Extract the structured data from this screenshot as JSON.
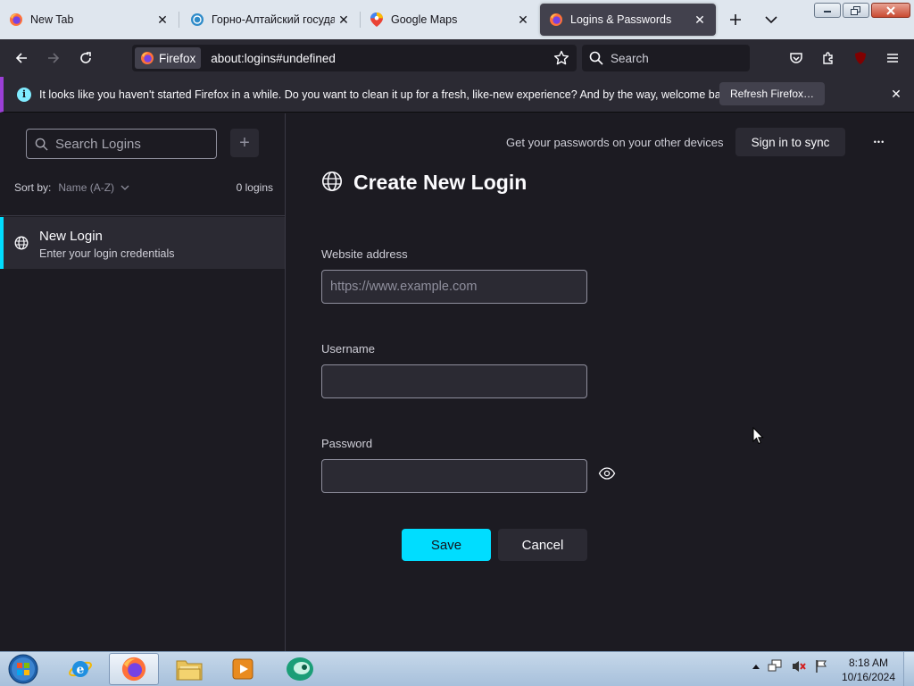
{
  "tabs": [
    {
      "title": "New Tab",
      "icon": "firefox-icon"
    },
    {
      "title": "Горно-Алтайский государственный университет",
      "icon": "site-icon"
    },
    {
      "title": "Google Maps",
      "icon": "maps-pin-icon"
    },
    {
      "title": "Logins & Passwords",
      "icon": "firefox-icon"
    }
  ],
  "nav": {
    "identity_label": "Firefox",
    "url": "about:logins#undefined",
    "search_placeholder": "Search",
    "extension_badge": "uO"
  },
  "notification": {
    "message": "It looks like you haven't started Firefox in a while. Do you want to clean it up for a fresh, like-new experience? And by the way, welcome back!",
    "refresh_label": "Refresh Firefox…"
  },
  "sidebar": {
    "search_placeholder": "Search Logins",
    "add_label": "+",
    "sort_label": "Sort by:",
    "sort_value": "Name (A-Z)",
    "count_label": "0 logins",
    "items": [
      {
        "title": "New Login",
        "subtitle": "Enter your login credentials"
      }
    ]
  },
  "main": {
    "sync_prompt": "Get your passwords on your other devices",
    "sync_button": "Sign in to sync",
    "more_label": "•••",
    "title": "Create New Login",
    "website_label": "Website address",
    "website_placeholder": "https://www.example.com",
    "website_value": "",
    "username_label": "Username",
    "username_value": "",
    "password_label": "Password",
    "password_value": "",
    "save_label": "Save",
    "cancel_label": "Cancel"
  },
  "taskbar": {
    "items": [
      "start-orb",
      "internet-explorer",
      "firefox",
      "file-explorer",
      "media-player",
      "app"
    ],
    "time": "8:18 AM",
    "date": "10/16/2024"
  },
  "colors": {
    "accent": "#00ddff",
    "surface": "#1c1b22",
    "panel": "#2b2a33",
    "notification_stripe": "#9b3fd6"
  }
}
